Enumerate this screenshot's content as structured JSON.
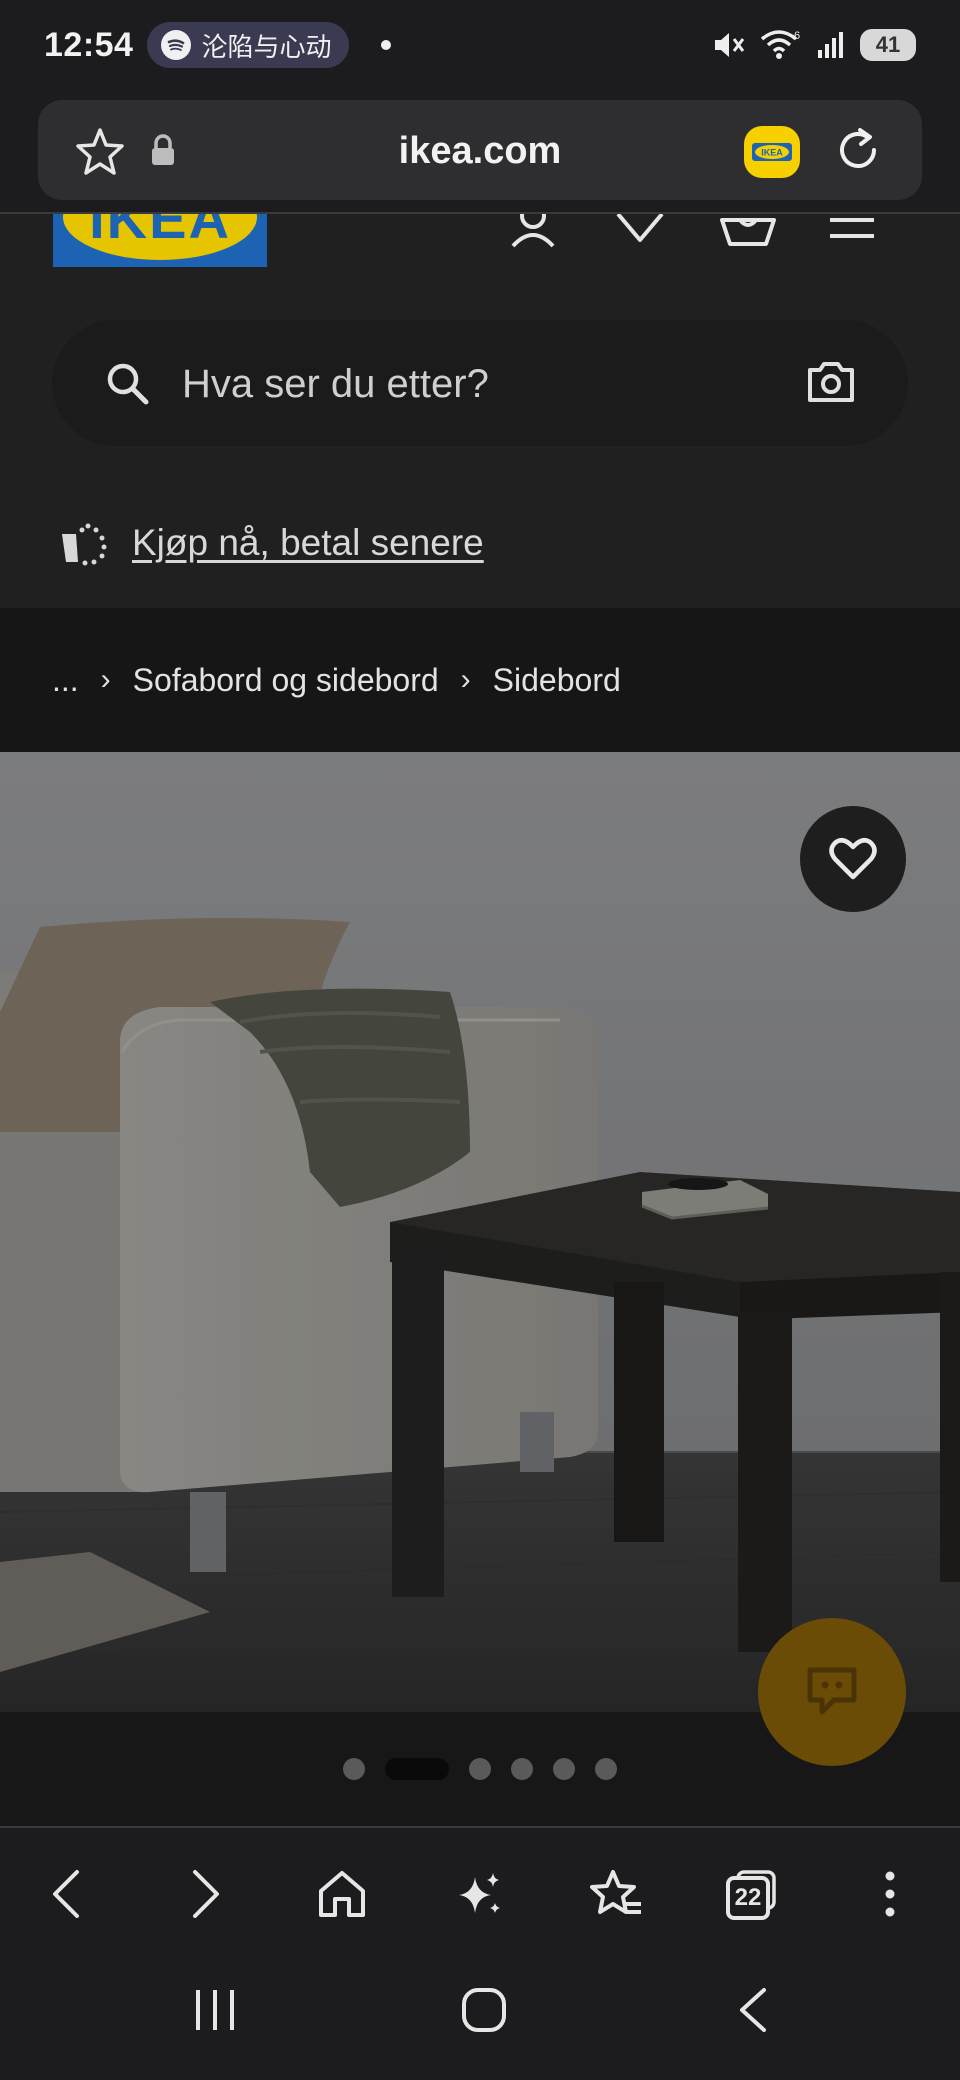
{
  "status_bar": {
    "time": "12:54",
    "media_title": "沦陷与心动",
    "battery": "41",
    "wifi_badge": "6"
  },
  "browser": {
    "url": "ikea.com",
    "tab_count": "22"
  },
  "site": {
    "logo_text": "IKEA",
    "search_placeholder": "Hva ser du etter?",
    "bnpl_label": "Kjøp nå, betal senere"
  },
  "breadcrumb": {
    "ellipsis": "...",
    "items": [
      "Sofabord og sidebord",
      "Sidebord"
    ]
  },
  "carousel": {
    "count": 6,
    "active_index": 1
  },
  "colors": {
    "brand_blue": "#1d63b3",
    "brand_yellow": "#f7d000",
    "chat_button": "#6b4c06"
  },
  "icons": [
    "star-icon",
    "lock-icon",
    "ikea-extension-icon",
    "reload-icon",
    "account-icon",
    "wishlist-icon",
    "cart-icon",
    "menu-icon",
    "search-icon",
    "camera-icon",
    "bnpl-icon",
    "heart-icon",
    "chat-icon",
    "back-icon",
    "forward-icon",
    "home-icon",
    "sparkle-icon",
    "bookmarks-icon",
    "tabs-icon",
    "more-icon",
    "recents-icon",
    "home-nav-icon",
    "back-nav-icon"
  ]
}
